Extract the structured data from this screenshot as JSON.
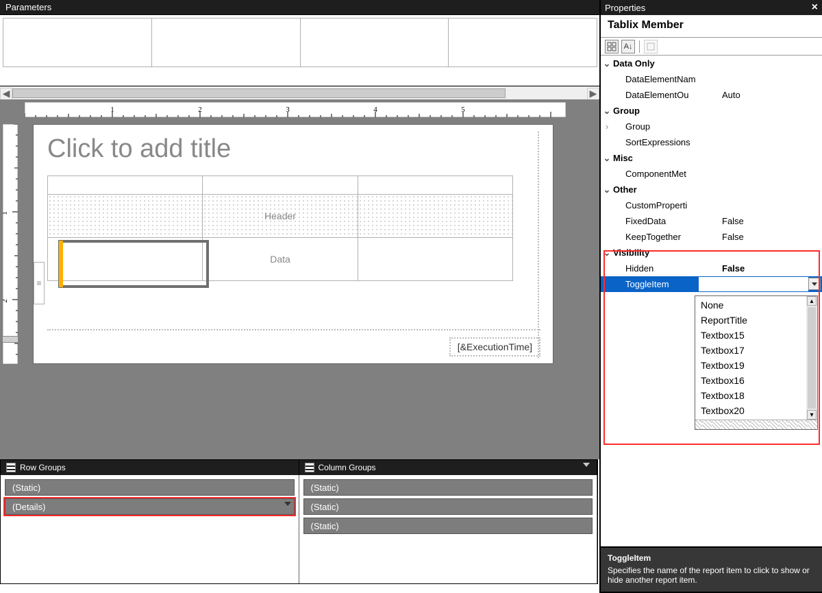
{
  "parameters": {
    "title": "Parameters"
  },
  "design": {
    "title_placeholder": "Click to add title",
    "tablix": {
      "header_label": "Header",
      "data_label": "Data"
    },
    "exec_time": "[&ExecutionTime]"
  },
  "row_groups": {
    "title": "Row Groups",
    "items": [
      "(Static)",
      "(Details)"
    ]
  },
  "col_groups": {
    "title": "Column Groups",
    "items": [
      "(Static)",
      "(Static)",
      "(Static)"
    ]
  },
  "properties": {
    "title": "Properties",
    "object": "Tablix Member",
    "categories": {
      "DataOnly": {
        "label": "Data Only",
        "props": {
          "DataElementName": {
            "label": "DataElementNam",
            "value": ""
          },
          "DataElementOutput": {
            "label": "DataElementOu",
            "value": "Auto"
          }
        }
      },
      "Group": {
        "label": "Group",
        "props": {
          "Group": {
            "label": "Group",
            "value": "",
            "expander": ">"
          },
          "SortExpressions": {
            "label": "SortExpressions",
            "value": ""
          }
        }
      },
      "Misc": {
        "label": "Misc",
        "props": {
          "ComponentMetadata": {
            "label": "ComponentMet",
            "value": ""
          }
        }
      },
      "Other": {
        "label": "Other",
        "props": {
          "CustomProperties": {
            "label": "CustomProperti",
            "value": ""
          },
          "FixedData": {
            "label": "FixedData",
            "value": "False"
          },
          "KeepTogether": {
            "label": "KeepTogether",
            "value": "False"
          }
        }
      },
      "Visibility": {
        "label": "Visibility",
        "props": {
          "Hidden": {
            "label": "Hidden",
            "value": "False",
            "bold": true
          },
          "ToggleItem": {
            "label": "ToggleItem",
            "value": "",
            "selected": true
          }
        }
      }
    },
    "dropdown": {
      "options": [
        "None",
        "ReportTitle",
        "Textbox15",
        "Textbox17",
        "Textbox19",
        "Textbox16",
        "Textbox18",
        "Textbox20"
      ]
    },
    "footer": {
      "name": "ToggleItem",
      "desc": "Specifies the name of the report item to click to show or hide another report item."
    }
  }
}
